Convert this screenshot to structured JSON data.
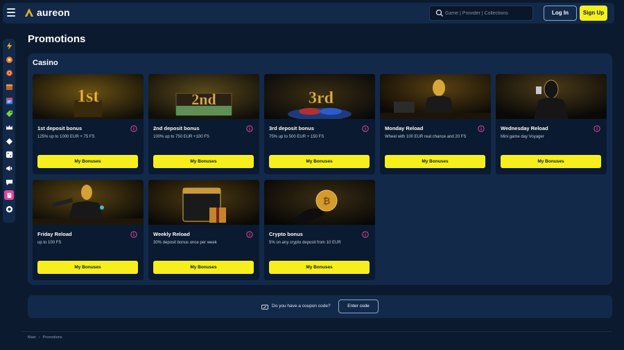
{
  "header": {
    "logo_text": "aureon",
    "search_placeholder": "Game | Provider | Collections",
    "login_label": "Log In",
    "signup_label": "Sign Up"
  },
  "sidebar": {
    "items": [
      "lightning-icon",
      "lotto-ball-icon",
      "poker-chip-icon",
      "treasure-chest-icon",
      "calendar-icon",
      "tag-icon",
      "crown-icon",
      "diamond-icon",
      "dice-icon",
      "megaphone-icon",
      "chat-icon",
      "promo-icon",
      "support-icon"
    ]
  },
  "page": {
    "title": "Promotions"
  },
  "casino": {
    "title": "Casino",
    "cards": [
      {
        "title": "1st deposit bonus",
        "desc": "125% up to 1000 EUR + 75 FS",
        "button": "My Bonuses"
      },
      {
        "title": "2nd deposit bonus",
        "desc": "100% up to 750 EUR +100 FS",
        "button": "My Bonuses"
      },
      {
        "title": "3rd deposit bonus",
        "desc": "75% up to 500 EUR + 150 FS",
        "button": "My Bonuses"
      },
      {
        "title": "Monday Reload",
        "desc": "Wheel with 100 EUR real chance and 20 FS",
        "button": "My Bonuses"
      },
      {
        "title": "Wednesday Reload",
        "desc": "Mini game day Voyager",
        "button": "My Bonuses"
      },
      {
        "title": "Friday Reload",
        "desc": "up to 100 FS",
        "button": "My Bonuses"
      },
      {
        "title": "Weekly Reload",
        "desc": "30% deposit bonus once per week",
        "button": "My Bonuses"
      },
      {
        "title": "Crypto bonus",
        "desc": "5% on any crypto deposit from 10 EUR",
        "button": "My Bonuses"
      }
    ],
    "image_labels": [
      "1st",
      "2nd",
      "3rd"
    ]
  },
  "coupon": {
    "question": "Do you have a coupon code?",
    "button": "Enter code"
  },
  "breadcrumb": {
    "home": "Main",
    "current": "Promotions"
  },
  "colors": {
    "background": "#0b1a2e",
    "panel": "#12294a",
    "accent": "#f6ef1c",
    "info": "#e0479e"
  }
}
